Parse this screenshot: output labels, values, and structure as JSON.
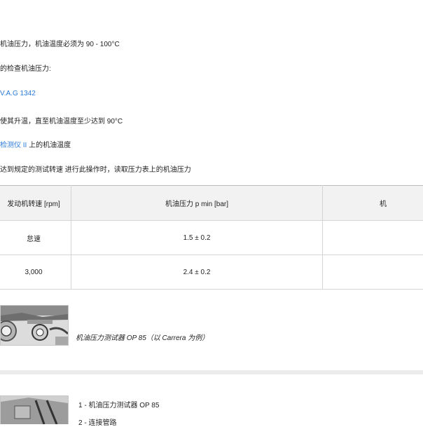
{
  "lines": [
    "机油压力，机油温度必须为 90 - 100°C",
    "的检查机油压力:",
    "V.A.G 1342",
    "使其升温，直至机油温度至少达到 90°C",
    "上的机油温度",
    "达到规定的测试转速 进行此操作时，读取压力表上的机油压力"
  ],
  "tester_link": "检测仪 II",
  "table": {
    "headers": [
      "发动机转速 [rpm]",
      "机油压力 p min [bar]",
      "机"
    ],
    "rows": [
      [
        "怠速",
        "1.5 ± 0.2",
        ""
      ],
      [
        "3,000",
        "2.4 ± 0.2",
        ""
      ]
    ]
  },
  "figure1": {
    "caption": "机油压力测试器 OP 85（以 Carrera 为例）"
  },
  "figure2": {
    "legend": [
      "1  - 机油压力测试器 OP 85",
      "2  - 连接管路"
    ]
  },
  "colors": {
    "link": "#2a7ad8",
    "header_bg": "#f2f2f2",
    "border": "#d5d5d5"
  }
}
